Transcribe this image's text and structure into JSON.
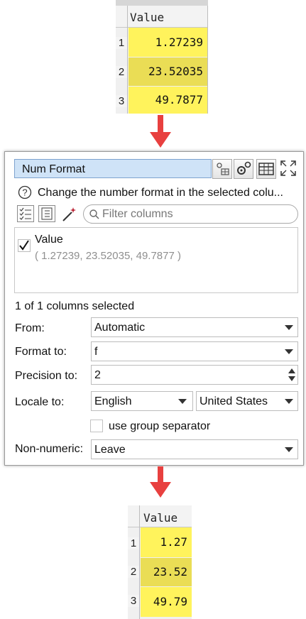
{
  "top_table": {
    "header": "Value",
    "rows": [
      {
        "num": "1",
        "value": "1.27239"
      },
      {
        "num": "2",
        "value": "23.52035"
      },
      {
        "num": "3",
        "value": "49.7877"
      }
    ]
  },
  "panel": {
    "title": "Num Format",
    "description": "Change the number format in the selected colu...",
    "filter_placeholder": "Filter columns",
    "column_item": {
      "name": "Value",
      "sample": "( 1.27239, 23.52035, 49.7877 )",
      "checked": true
    },
    "selection_status": "1 of 1 columns selected",
    "from": {
      "label": "From:",
      "value": "Automatic"
    },
    "format_to": {
      "label": "Format to:",
      "value": "f"
    },
    "precision_to": {
      "label": "Precision to:",
      "value": "2"
    },
    "locale_to": {
      "label": "Locale to:",
      "language": "English",
      "country": "United States"
    },
    "group_separator": {
      "label": "use group separator",
      "checked": false
    },
    "non_numeric": {
      "label": "Non-numeric:",
      "value": "Leave"
    }
  },
  "bottom_table": {
    "header": "Value",
    "rows": [
      {
        "num": "1",
        "value": "1.27"
      },
      {
        "num": "2",
        "value": "23.52"
      },
      {
        "num": "3",
        "value": "49.79"
      }
    ]
  },
  "colors": {
    "cell_yellow": "#fff35c",
    "cell_yellow_dark": "#eadd55",
    "arrow": "#e8403f",
    "title_bg": "#cfe3f7"
  }
}
